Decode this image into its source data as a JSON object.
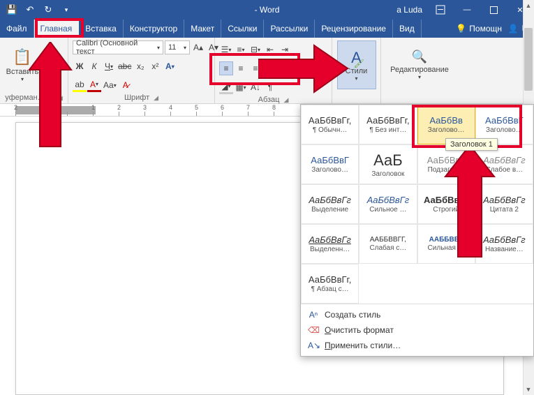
{
  "titlebar": {
    "app_title": "- Word",
    "user": "a Luda"
  },
  "qat": {
    "save": "save",
    "undo": "undo",
    "redo": "redo",
    "customize": "▾"
  },
  "tabs": {
    "file": "Файл",
    "items": [
      "Главная",
      "Вставка",
      "Конструктор",
      "Макет",
      "Ссылки",
      "Рассылки",
      "Рецензирование",
      "Вид"
    ],
    "active_index": 0,
    "help_label": "Помощн"
  },
  "ribbon": {
    "clipboard": {
      "paste_label": "Вставить",
      "group_label": "уферман…на"
    },
    "font": {
      "group_label": "Шрифт",
      "font_name": "Calibri (Основной текст",
      "font_size": "11"
    },
    "paragraph": {
      "group_label": "Абзац"
    },
    "styles": {
      "button_label": "Стили"
    },
    "editing": {
      "group_label": "Редактирование"
    }
  },
  "ruler": {
    "numbers": [
      "2",
      "1",
      "",
      "1",
      "2",
      "3",
      "4",
      "5",
      "6",
      "7",
      "8"
    ]
  },
  "gallery": {
    "cells": [
      {
        "sample": "АаБбВвГг,",
        "name": "¶ Обычн…",
        "cls": ""
      },
      {
        "sample": "АаБбВвГг,",
        "name": "¶ Без инт…",
        "cls": ""
      },
      {
        "sample": "АаБбВв",
        "name": "Заголово…",
        "cls": "blue hover"
      },
      {
        "sample": "АаБбВвГ",
        "name": "Заголово…",
        "cls": "blue"
      },
      {
        "sample": "АаБбВвГ",
        "name": "Заголово…",
        "cls": "blue"
      },
      {
        "sample": "АаБ",
        "name": "Заголовок",
        "cls": "big"
      },
      {
        "sample": "АаБбВвГ",
        "name": "Подзагол…",
        "cls": "gray"
      },
      {
        "sample": "АаБбВвГг",
        "name": "Слабое в…",
        "cls": "italic gray"
      },
      {
        "sample": "АаБбВвГг",
        "name": "Выделение",
        "cls": "italic"
      },
      {
        "sample": "АаБбВвГг",
        "name": "Сильное …",
        "cls": "italic blue"
      },
      {
        "sample": "АаБбВвГг",
        "name": "Строгий",
        "cls": "bold"
      },
      {
        "sample": "АаБбВвГг",
        "name": "Цитата 2",
        "cls": "italic"
      },
      {
        "sample": "АаБбВвГг",
        "name": "Выделенн…",
        "cls": "italic under"
      },
      {
        "sample": "ААББВВГГ,",
        "name": "Слабая с…",
        "cls": "small"
      },
      {
        "sample": "ААББВВГ",
        "name": "Сильная …",
        "cls": "bold blue small"
      },
      {
        "sample": "АаБбВвГг",
        "name": "Название…",
        "cls": "italic"
      },
      {
        "sample": "АаБбВвГг,",
        "name": "¶ Абзац с…",
        "cls": ""
      }
    ],
    "tooltip": "Заголовок 1",
    "menu": {
      "create": "Создать стиль",
      "clear": "Очистить формат",
      "apply": "Применить стили…"
    }
  }
}
